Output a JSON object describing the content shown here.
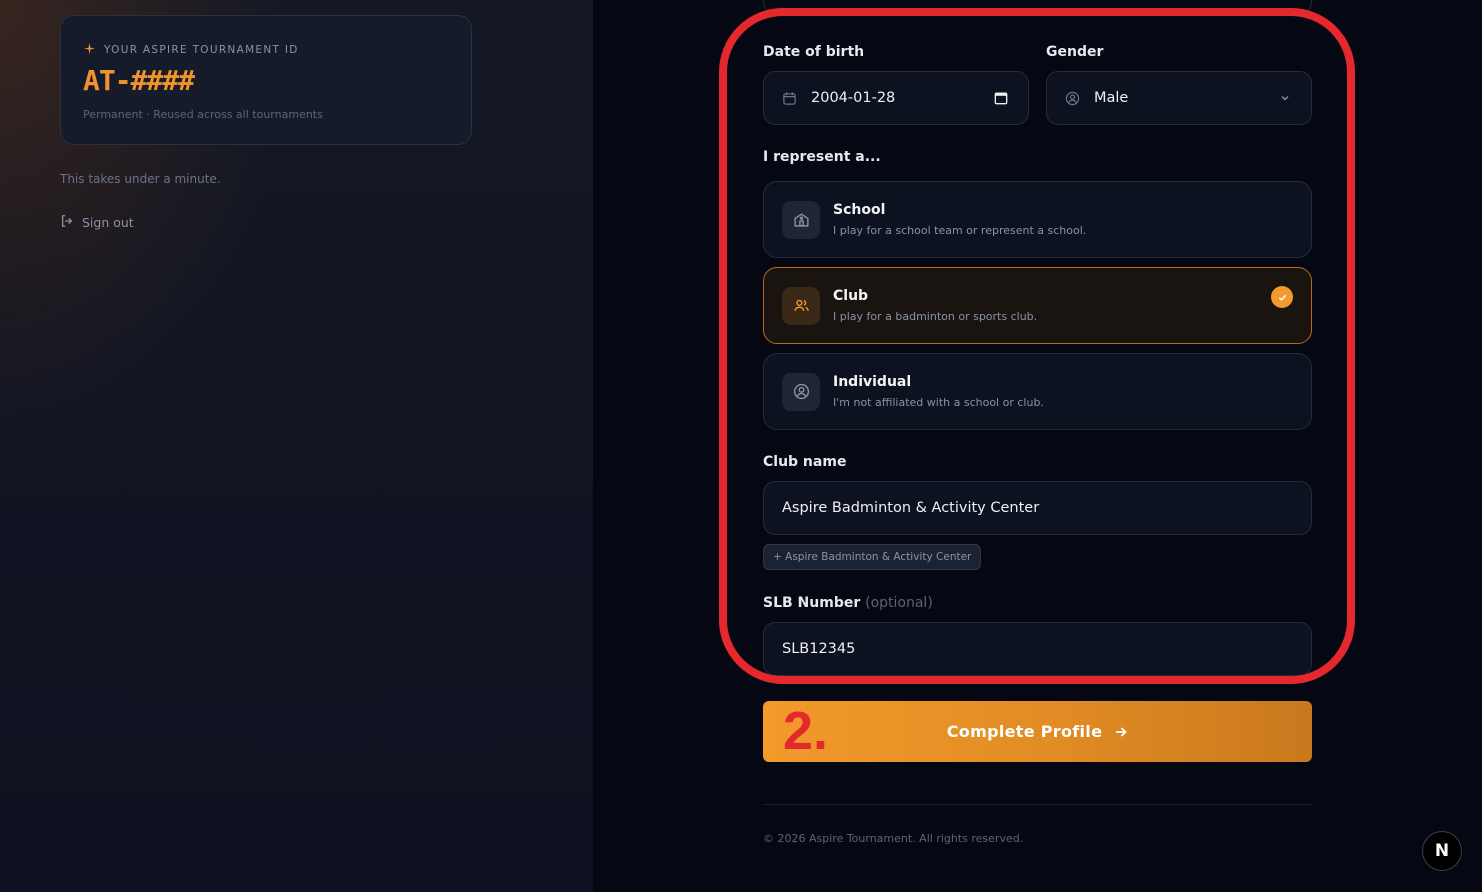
{
  "sidebar": {
    "id_label": "YOUR ASPIRE TOURNAMENT ID",
    "id_value": "AT-####",
    "id_note": "Permanent · Reused across all tournaments",
    "takes_text": "This takes under a minute.",
    "signout_label": "Sign out"
  },
  "form": {
    "dob_label": "Date of birth",
    "dob_value": "2004-01-28",
    "gender_label": "Gender",
    "gender_value": "Male",
    "represent_label": "I represent a...",
    "options": [
      {
        "title": "School",
        "desc": "I play for a school team or represent a school.",
        "icon": "school-icon",
        "selected": false
      },
      {
        "title": "Club",
        "desc": "I play for a badminton or sports club.",
        "icon": "users-icon",
        "selected": true
      },
      {
        "title": "Individual",
        "desc": "I'm not affiliated with a school or club.",
        "icon": "user-circle-icon",
        "selected": false
      }
    ],
    "club_label": "Club name",
    "club_value": "Aspire Badminton & Activity Center",
    "club_suggestion": "+ Aspire Badminton & Activity Center",
    "slb_label": "SLB Number",
    "slb_optional": "(optional)",
    "slb_value": "SLB12345",
    "submit_label": "Complete Profile"
  },
  "annotation": {
    "step": "2.",
    "color": "#e5282e"
  },
  "footer": {
    "copyright": "© 2026 Aspire Tournament. All rights reserved."
  },
  "badge": {
    "letter": "N"
  },
  "colors": {
    "accent": "#f29a2e",
    "background": "#050812"
  }
}
